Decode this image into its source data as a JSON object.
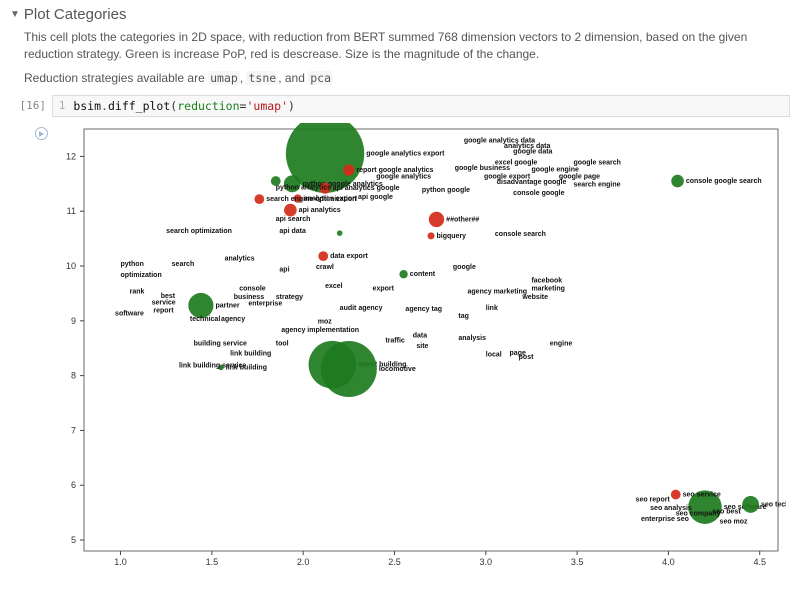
{
  "header": {
    "title": "Plot Categories"
  },
  "desc1": "This cell plots the categories in 2D space, with reduction from BERT summed 768 dimension vectors to 2 dimension, based on the given reduction strategy. Green is increase PoP, red is descrease. Size is the magnitude of the change.",
  "desc2_pre": "Reduction strategies available are ",
  "desc2_codes": [
    "umap",
    "tsne",
    "pca"
  ],
  "desc2_seps": [
    ", ",
    ", and "
  ],
  "cell": {
    "exec": "[16]",
    "lineno": "1",
    "ident": "bsim",
    "method": "diff_plot",
    "argname": "reduction",
    "argval": "'umap'"
  },
  "chart_data": {
    "type": "scatter",
    "xlabel": "",
    "ylabel": "",
    "xlim": [
      0.8,
      4.6
    ],
    "ylim": [
      4.8,
      12.5
    ],
    "xticks": [
      1.0,
      1.5,
      2.0,
      2.5,
      3.0,
      3.5,
      4.0,
      4.5
    ],
    "yticks": [
      5,
      6,
      7,
      8,
      9,
      10,
      11,
      12
    ],
    "series": [
      {
        "name": "green",
        "color": "#1e7b1e",
        "points": [
          {
            "x": 2.12,
            "y": 12.05,
            "label": "google analytics export",
            "size": 56
          },
          {
            "x": 1.85,
            "y": 11.55,
            "label": "",
            "size": 7
          },
          {
            "x": 1.94,
            "y": 11.5,
            "label": "python google analytics",
            "size": 12
          },
          {
            "x": 4.05,
            "y": 11.55,
            "label": "console google search",
            "size": 9
          },
          {
            "x": 2.16,
            "y": 8.2,
            "label": "intent building",
            "size": 34
          },
          {
            "x": 2.25,
            "y": 8.12,
            "label": "locomotive",
            "size": 40
          },
          {
            "x": 1.44,
            "y": 9.28,
            "label": "partner",
            "size": 18
          },
          {
            "x": 2.55,
            "y": 9.85,
            "label": "content",
            "size": 6
          },
          {
            "x": 2.2,
            "y": 10.6,
            "label": "",
            "size": 4
          },
          {
            "x": 4.2,
            "y": 5.6,
            "label": "seo software",
            "size": 24
          },
          {
            "x": 4.45,
            "y": 5.65,
            "label": "seo technical",
            "size": 12
          },
          {
            "x": 1.55,
            "y": 8.15,
            "label": "link building",
            "size": 4
          }
        ]
      },
      {
        "name": "red",
        "color": "#d42a1a",
        "points": [
          {
            "x": 2.25,
            "y": 11.75,
            "label": "report google analytics",
            "size": 8
          },
          {
            "x": 2.12,
            "y": 11.42,
            "label": "api analytics google",
            "size": 8
          },
          {
            "x": 1.97,
            "y": 11.23,
            "label": "analytics export",
            "size": 6
          },
          {
            "x": 1.76,
            "y": 11.22,
            "label": "search engine optimization",
            "size": 7
          },
          {
            "x": 1.93,
            "y": 11.02,
            "label": "api analytics",
            "size": 9
          },
          {
            "x": 2.73,
            "y": 10.85,
            "label": "##other##",
            "size": 11
          },
          {
            "x": 2.7,
            "y": 10.55,
            "label": "bigquery",
            "size": 5
          },
          {
            "x": 2.11,
            "y": 10.18,
            "label": "data export",
            "size": 7
          },
          {
            "x": 4.04,
            "y": 5.83,
            "label": "seo service",
            "size": 7
          }
        ]
      }
    ],
    "text_labels": [
      {
        "x": 2.4,
        "y": 11.6,
        "label": "google analytics"
      },
      {
        "x": 2.88,
        "y": 12.25,
        "label": "google analytics data"
      },
      {
        "x": 3.1,
        "y": 12.15,
        "label": "analytics data"
      },
      {
        "x": 3.15,
        "y": 12.05,
        "label": "google data"
      },
      {
        "x": 3.05,
        "y": 11.85,
        "label": "excel google"
      },
      {
        "x": 3.48,
        "y": 11.85,
        "label": "google search"
      },
      {
        "x": 3.25,
        "y": 11.72,
        "label": "google engine"
      },
      {
        "x": 2.83,
        "y": 11.75,
        "label": "google business"
      },
      {
        "x": 2.99,
        "y": 11.6,
        "label": "google export"
      },
      {
        "x": 3.06,
        "y": 11.5,
        "label": "disadvantage google"
      },
      {
        "x": 3.4,
        "y": 11.6,
        "label": "google page"
      },
      {
        "x": 3.48,
        "y": 11.45,
        "label": "search engine"
      },
      {
        "x": 3.15,
        "y": 11.3,
        "label": "console google"
      },
      {
        "x": 2.65,
        "y": 11.35,
        "label": "python google"
      },
      {
        "x": 1.85,
        "y": 11.4,
        "label": "python analytics"
      },
      {
        "x": 2.3,
        "y": 11.22,
        "label": "api google"
      },
      {
        "x": 1.85,
        "y": 10.82,
        "label": "api search"
      },
      {
        "x": 1.87,
        "y": 10.6,
        "label": "api data"
      },
      {
        "x": 1.25,
        "y": 10.6,
        "label": "search optimization"
      },
      {
        "x": 3.05,
        "y": 10.55,
        "label": "console search"
      },
      {
        "x": 1.57,
        "y": 10.1,
        "label": "analytics"
      },
      {
        "x": 1.28,
        "y": 10.0,
        "label": "search"
      },
      {
        "x": 1.0,
        "y": 10.0,
        "label": "python"
      },
      {
        "x": 1.0,
        "y": 9.8,
        "label": "optimization"
      },
      {
        "x": 1.87,
        "y": 9.9,
        "label": "api"
      },
      {
        "x": 2.07,
        "y": 9.95,
        "label": "crawl"
      },
      {
        "x": 2.82,
        "y": 9.95,
        "label": "google"
      },
      {
        "x": 1.65,
        "y": 9.55,
        "label": "console"
      },
      {
        "x": 2.12,
        "y": 9.6,
        "label": "excel"
      },
      {
        "x": 2.38,
        "y": 9.55,
        "label": "export"
      },
      {
        "x": 1.62,
        "y": 9.4,
        "label": "business"
      },
      {
        "x": 1.7,
        "y": 9.28,
        "label": "enterprise"
      },
      {
        "x": 1.85,
        "y": 9.4,
        "label": "strategy"
      },
      {
        "x": 1.05,
        "y": 9.5,
        "label": "rank"
      },
      {
        "x": 1.22,
        "y": 9.42,
        "label": "best"
      },
      {
        "x": 1.17,
        "y": 9.3,
        "label": "service"
      },
      {
        "x": 0.97,
        "y": 9.1,
        "label": "software"
      },
      {
        "x": 1.18,
        "y": 9.15,
        "label": "report"
      },
      {
        "x": 1.38,
        "y": 9.0,
        "label": "technical"
      },
      {
        "x": 1.55,
        "y": 9.0,
        "label": "agency"
      },
      {
        "x": 2.2,
        "y": 9.2,
        "label": "audit agency"
      },
      {
        "x": 2.56,
        "y": 9.18,
        "label": "agency tag"
      },
      {
        "x": 2.85,
        "y": 9.05,
        "label": "tag"
      },
      {
        "x": 2.08,
        "y": 8.95,
        "label": "moz"
      },
      {
        "x": 1.88,
        "y": 8.8,
        "label": "agency implementation"
      },
      {
        "x": 2.9,
        "y": 9.5,
        "label": "agency marketing"
      },
      {
        "x": 3.25,
        "y": 9.7,
        "label": "facebook"
      },
      {
        "x": 3.25,
        "y": 9.55,
        "label": "marketing"
      },
      {
        "x": 3.2,
        "y": 9.4,
        "label": "website"
      },
      {
        "x": 3.0,
        "y": 9.2,
        "label": "link"
      },
      {
        "x": 1.4,
        "y": 8.55,
        "label": "building service"
      },
      {
        "x": 1.6,
        "y": 8.37,
        "label": "link building"
      },
      {
        "x": 1.32,
        "y": 8.15,
        "label": "link building service"
      },
      {
        "x": 1.85,
        "y": 8.55,
        "label": "tool"
      },
      {
        "x": 2.45,
        "y": 8.6,
        "label": "traffic"
      },
      {
        "x": 2.6,
        "y": 8.7,
        "label": "data"
      },
      {
        "x": 2.62,
        "y": 8.5,
        "label": "site"
      },
      {
        "x": 2.85,
        "y": 8.65,
        "label": "analysis"
      },
      {
        "x": 3.0,
        "y": 8.35,
        "label": "local"
      },
      {
        "x": 3.13,
        "y": 8.38,
        "label": "page"
      },
      {
        "x": 3.18,
        "y": 8.3,
        "label": "post"
      },
      {
        "x": 3.35,
        "y": 8.55,
        "label": "engine"
      },
      {
        "x": 3.82,
        "y": 5.7,
        "label": "seo report"
      },
      {
        "x": 3.9,
        "y": 5.55,
        "label": "seo analysis"
      },
      {
        "x": 4.04,
        "y": 5.45,
        "label": "seo company"
      },
      {
        "x": 4.24,
        "y": 5.48,
        "label": "seo best"
      },
      {
        "x": 3.85,
        "y": 5.35,
        "label": "enterprise seo"
      },
      {
        "x": 4.28,
        "y": 5.3,
        "label": "seo moz"
      }
    ]
  }
}
